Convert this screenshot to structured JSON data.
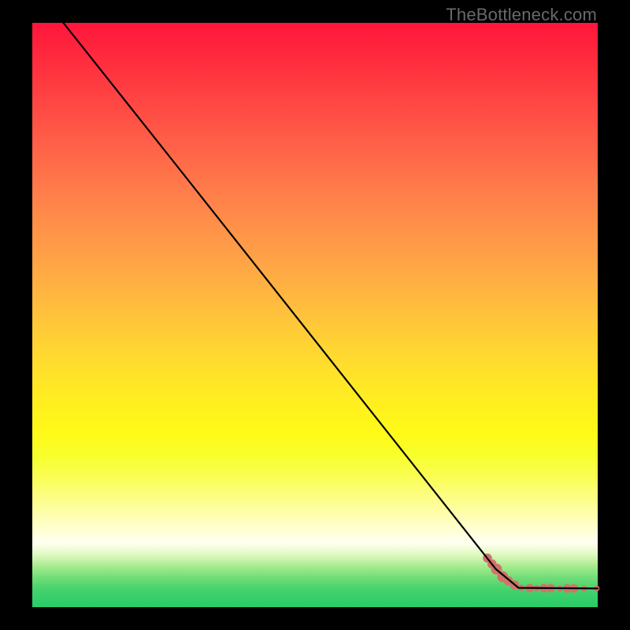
{
  "watermark": "TheBottleneck.com",
  "chart_data": {
    "type": "line",
    "title": "",
    "xlabel": "",
    "ylabel": "",
    "xlim": [
      0,
      100
    ],
    "ylim": [
      0,
      100
    ],
    "curve": [
      {
        "x": 5.5,
        "y": 100
      },
      {
        "x": 26,
        "y": 75
      },
      {
        "x": 82,
        "y": 6.5
      },
      {
        "x": 86,
        "y": 3.3
      },
      {
        "x": 100,
        "y": 3.2
      }
    ],
    "scatter_points": [
      {
        "x": 80.5,
        "y": 8.4,
        "r": 5.8
      },
      {
        "x": 81.3,
        "y": 7.4,
        "r": 5.8
      },
      {
        "x": 82.1,
        "y": 6.5,
        "r": 7.0
      },
      {
        "x": 83.2,
        "y": 5.2,
        "r": 7.0
      },
      {
        "x": 84.2,
        "y": 4.5,
        "r": 5.8
      },
      {
        "x": 85.3,
        "y": 3.8,
        "r": 5.8
      },
      {
        "x": 86.5,
        "y": 3.3,
        "r": 4.0
      },
      {
        "x": 88.0,
        "y": 3.25,
        "r": 5.5
      },
      {
        "x": 89.2,
        "y": 3.25,
        "r": 4.0
      },
      {
        "x": 90.5,
        "y": 3.25,
        "r": 5.5
      },
      {
        "x": 91.7,
        "y": 3.25,
        "r": 5.5
      },
      {
        "x": 93.3,
        "y": 3.2,
        "r": 3.7
      },
      {
        "x": 94.6,
        "y": 3.2,
        "r": 5.5
      },
      {
        "x": 95.8,
        "y": 3.2,
        "r": 5.5
      },
      {
        "x": 97.6,
        "y": 3.2,
        "r": 3.7
      },
      {
        "x": 99.8,
        "y": 3.2,
        "r": 3.7
      }
    ],
    "point_color": "#d1736b",
    "line_color": "#000000"
  }
}
